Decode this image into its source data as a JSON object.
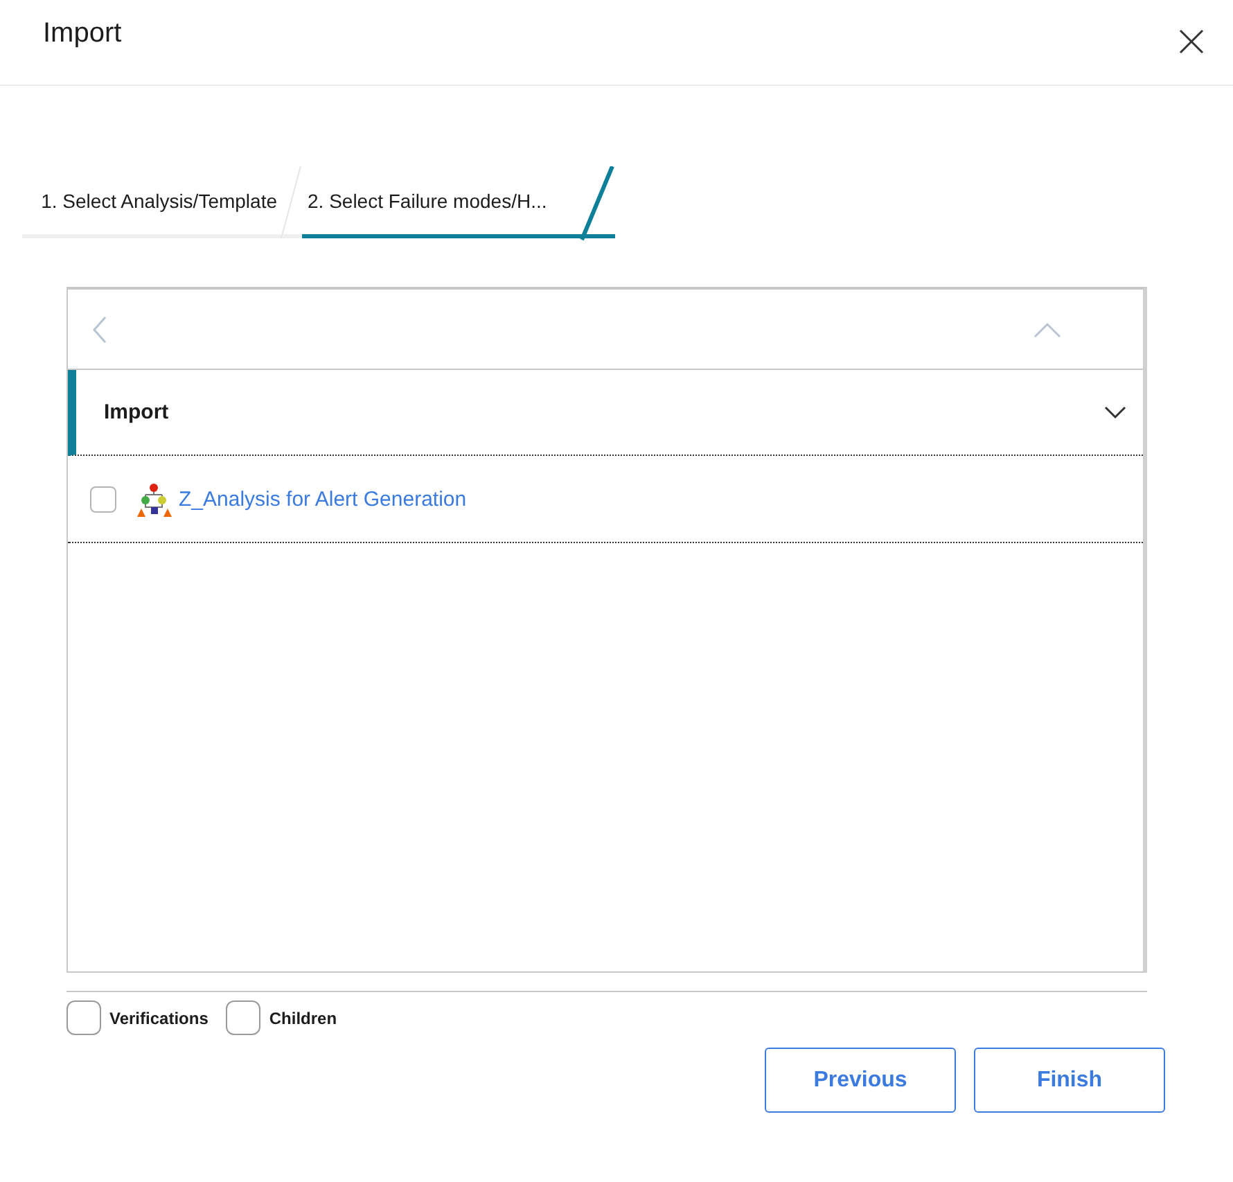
{
  "window": {
    "title": "Import"
  },
  "steps": [
    {
      "label": "1. Select Analysis/Template",
      "selected": false
    },
    {
      "label": "2. Select Failure modes/H...",
      "selected": true
    }
  ],
  "group": {
    "title": "Import",
    "items": [
      {
        "label": "Z_Analysis for Alert Generation",
        "checked": false
      }
    ]
  },
  "options": [
    {
      "label": "Verifications",
      "checked": false
    },
    {
      "label": "Children",
      "checked": false
    }
  ],
  "buttons": [
    "Previous",
    "Finish"
  ]
}
